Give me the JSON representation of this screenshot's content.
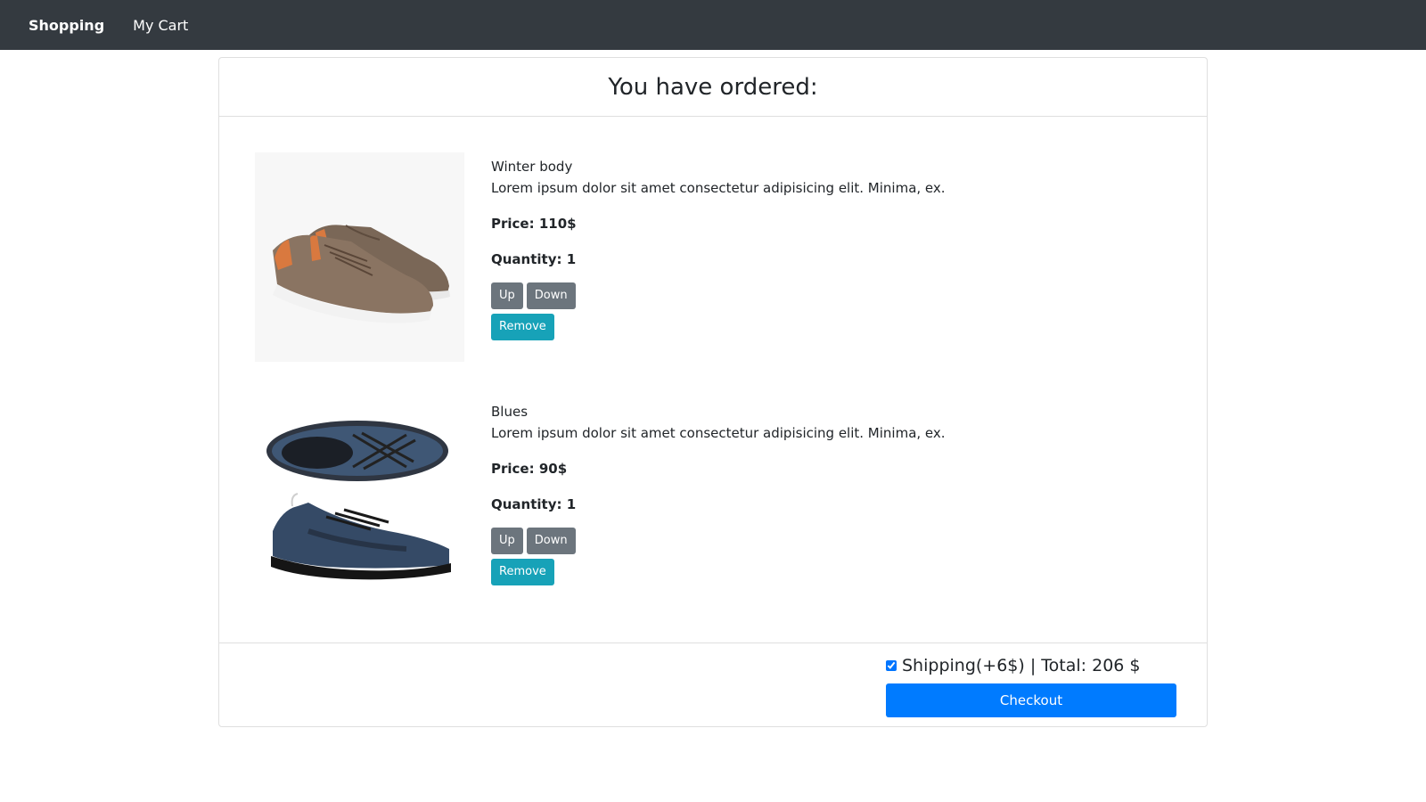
{
  "navbar": {
    "brand": "Shopping",
    "cart_link": "My Cart",
    "background": "#343a40"
  },
  "cart": {
    "heading": "You have ordered:",
    "items": [
      {
        "name": "Winter body",
        "description": "Lorem ipsum dolor sit amet consectetur adipisicing elit. Minima, ex.",
        "price": "Price: 110$",
        "quantity": "Quantity: 1",
        "image_icon": "brown-sneaker-image",
        "up_label": "Up",
        "down_label": "Down",
        "remove_label": "Remove"
      },
      {
        "name": "Blues",
        "description": "Lorem ipsum dolor sit amet consectetur adipisicing elit. Minima, ex.",
        "price": "Price: 90$",
        "quantity": "Quantity: 1",
        "image_icon": "blue-knit-sneaker-image",
        "up_label": "Up",
        "down_label": "Down",
        "remove_label": "Remove"
      }
    ]
  },
  "footer": {
    "shipping_checked": true,
    "shipping_text": "Shipping(+6$) | Total: 206 $",
    "checkout_label": "Checkout"
  },
  "colors": {
    "primary": "#007bff",
    "secondary": "#6c757d",
    "info": "#17a2b8"
  }
}
